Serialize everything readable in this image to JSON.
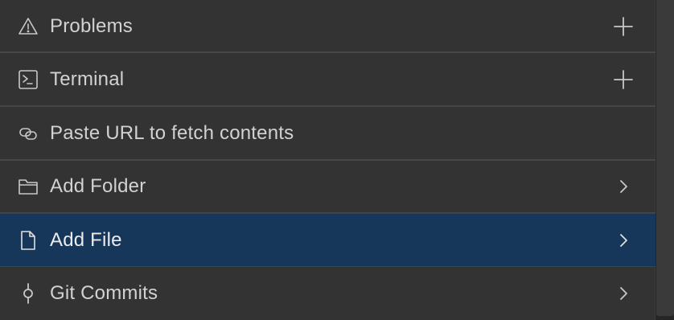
{
  "menu": {
    "items": [
      {
        "label": "Problems",
        "icon": "warning-icon",
        "trailing": "plus-icon",
        "selected": false
      },
      {
        "label": "Terminal",
        "icon": "terminal-icon",
        "trailing": "plus-icon",
        "selected": false
      },
      {
        "label": "Paste URL to fetch contents",
        "icon": "link-icon",
        "trailing": "",
        "selected": false
      },
      {
        "label": "Add Folder",
        "icon": "folder-icon",
        "trailing": "chevron-right-icon",
        "selected": false
      },
      {
        "label": "Add File",
        "icon": "file-icon",
        "trailing": "chevron-right-icon",
        "selected": true
      },
      {
        "label": "Git Commits",
        "icon": "git-commit-icon",
        "trailing": "chevron-right-icon",
        "selected": false
      }
    ]
  },
  "colors": {
    "background": "#333333",
    "selected_background": "#16375a",
    "text": "#d2d2d2",
    "icon": "#c8c8c8",
    "separator": "#474747"
  }
}
